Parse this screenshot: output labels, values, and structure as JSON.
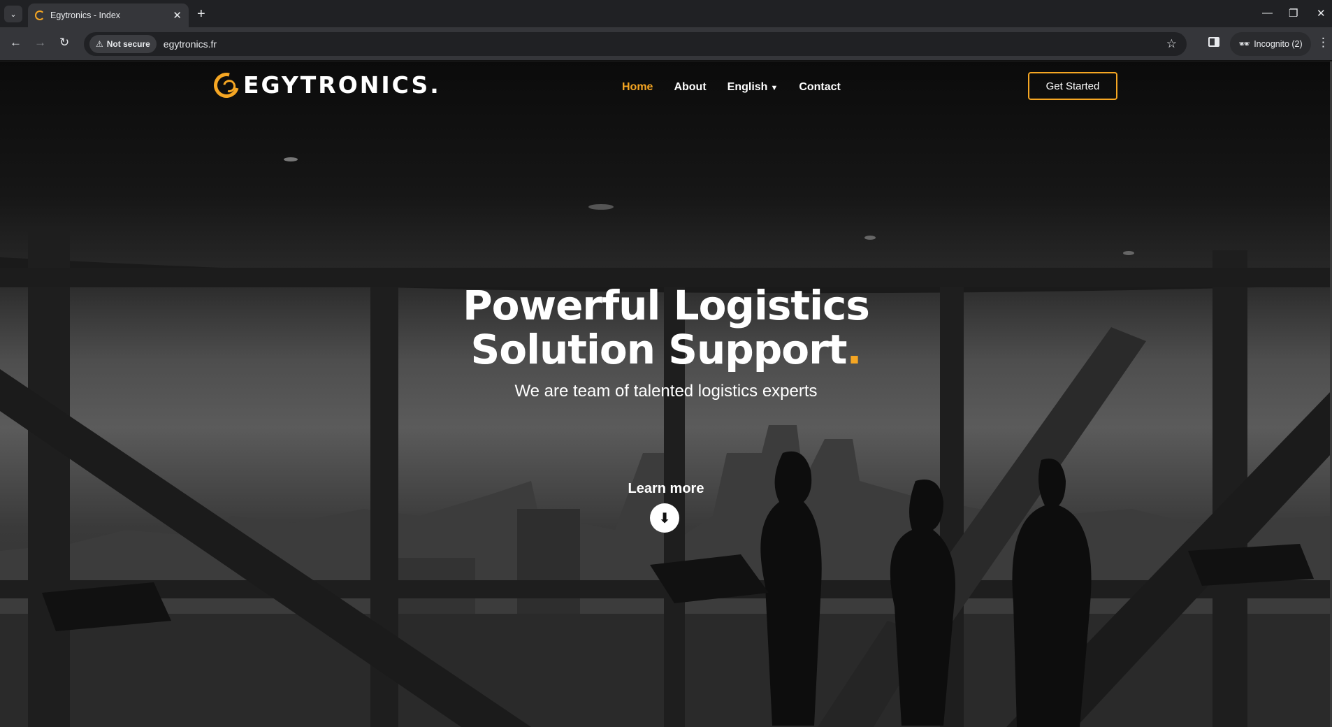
{
  "browser": {
    "tab_title": "Egytronics - Index",
    "tab_close": "✕",
    "new_tab": "+",
    "security_label": "Not secure",
    "url": "egytronics.fr",
    "incognito_label": "Incognito (2)",
    "window_controls": [
      "—",
      "❐",
      "✕"
    ]
  },
  "site": {
    "logo_text": "EGYTRONICS.",
    "nav": [
      {
        "label": "Home",
        "active": true
      },
      {
        "label": "About",
        "active": false
      },
      {
        "label": "English",
        "active": false
      },
      {
        "label": "Contact",
        "active": false
      }
    ],
    "cta_label": "Get Started"
  },
  "hero": {
    "title_line1": "Powerful Logistics",
    "title_line2": "Solution Support",
    "title_dot": ".",
    "subtitle": "We are team of talented logistics experts",
    "learn_more": "Learn more"
  },
  "colors": {
    "accent": "#f5a623",
    "chrome_dark": "#202124",
    "chrome_toolbar": "#35363a"
  },
  "icons": {
    "back": "back-arrow-icon",
    "forward": "forward-arrow-icon",
    "reload": "reload-icon",
    "warning": "warning-triangle-icon",
    "bookmark": "star-icon",
    "side_panel": "side-panel-icon",
    "incognito": "incognito-icon",
    "menu": "kebab-menu-icon",
    "scroll_down": "arrow-down-icon"
  }
}
